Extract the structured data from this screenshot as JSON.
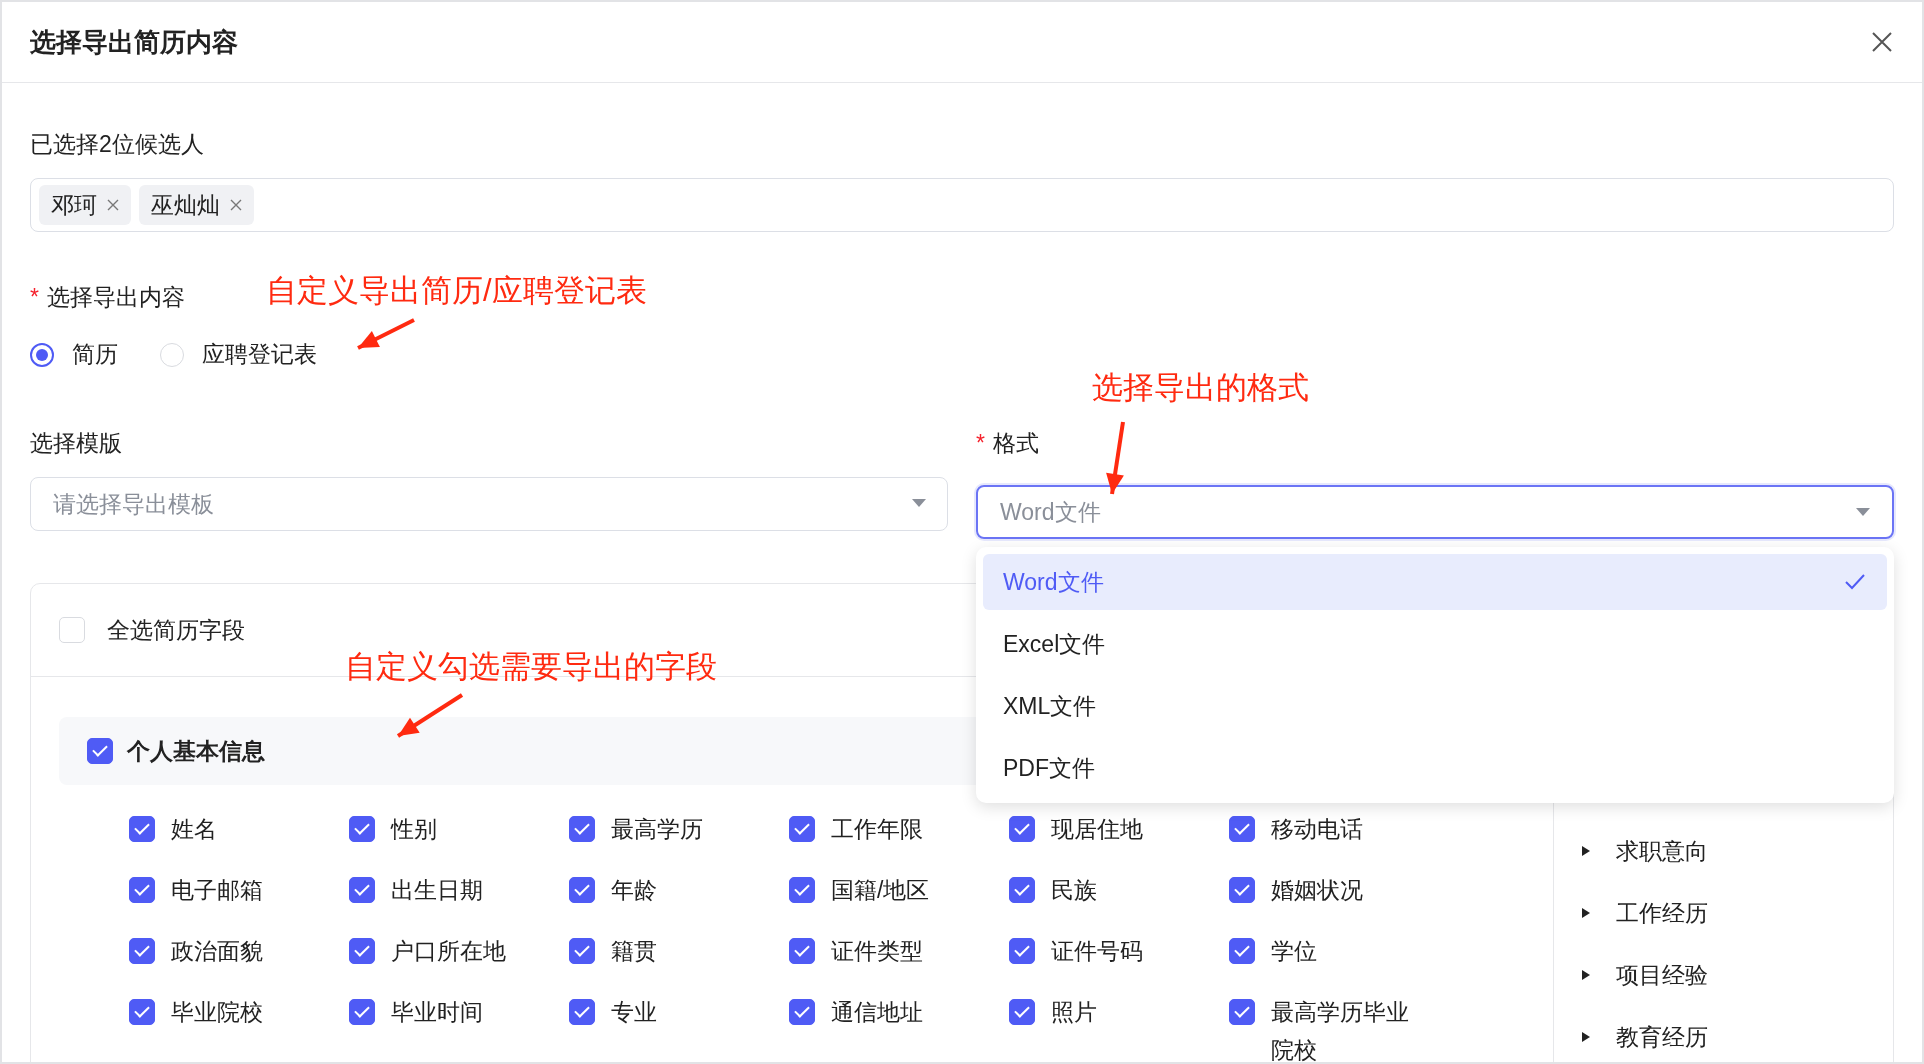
{
  "dialog": {
    "title": "选择导出简历内容"
  },
  "candidates": {
    "label": "已选择2位候选人",
    "tags": [
      {
        "name": "邓珂"
      },
      {
        "name": "巫灿灿"
      }
    ]
  },
  "export_content": {
    "required_mark": "*",
    "label": "选择导出内容",
    "options": [
      {
        "label": "简历",
        "selected": true
      },
      {
        "label": "应聘登记表",
        "selected": false
      }
    ]
  },
  "template": {
    "label": "选择模版",
    "placeholder": "请选择导出模板"
  },
  "format": {
    "required_mark": "*",
    "label": "格式",
    "value": "Word文件",
    "expanded": true,
    "options": [
      {
        "label": "Word文件",
        "selected": true
      },
      {
        "label": "Excel文件",
        "selected": false
      },
      {
        "label": "XML文件",
        "selected": false
      },
      {
        "label": "PDF文件",
        "selected": false
      }
    ]
  },
  "fields_panel": {
    "select_all": {
      "label": "全选简历字段",
      "checked": false
    },
    "groups": [
      {
        "title": "个人基本信息",
        "checked": true,
        "fields": [
          {
            "label": "姓名",
            "checked": true
          },
          {
            "label": "性别",
            "checked": true
          },
          {
            "label": "最高学历",
            "checked": true
          },
          {
            "label": "工作年限",
            "checked": true
          },
          {
            "label": "现居住地",
            "checked": true
          },
          {
            "label": "移动电话",
            "checked": true
          },
          {
            "label": "电子邮箱",
            "checked": true
          },
          {
            "label": "出生日期",
            "checked": true
          },
          {
            "label": "年龄",
            "checked": true
          },
          {
            "label": "国籍/地区",
            "checked": true
          },
          {
            "label": "民族",
            "checked": true
          },
          {
            "label": "婚姻状况",
            "checked": true
          },
          {
            "label": "政治面貌",
            "checked": true
          },
          {
            "label": "户口所在地",
            "checked": true
          },
          {
            "label": "籍贯",
            "checked": true
          },
          {
            "label": "证件类型",
            "checked": true
          },
          {
            "label": "证件号码",
            "checked": true
          },
          {
            "label": "学位",
            "checked": true
          },
          {
            "label": "毕业院校",
            "checked": true
          },
          {
            "label": "毕业时间",
            "checked": true
          },
          {
            "label": "专业",
            "checked": true
          },
          {
            "label": "通信地址",
            "checked": true
          },
          {
            "label": "照片",
            "checked": true
          },
          {
            "label": "最高学历毕业院校",
            "checked": true
          }
        ]
      }
    ],
    "nav": [
      {
        "label": "求职意向"
      },
      {
        "label": "工作经历"
      },
      {
        "label": "项目经验"
      },
      {
        "label": "教育经历"
      }
    ]
  },
  "annotations": [
    {
      "text": "自定义导出简历/应聘登记表"
    },
    {
      "text": "选择导出的格式"
    },
    {
      "text": "自定义勾选需要导出的字段"
    }
  ]
}
